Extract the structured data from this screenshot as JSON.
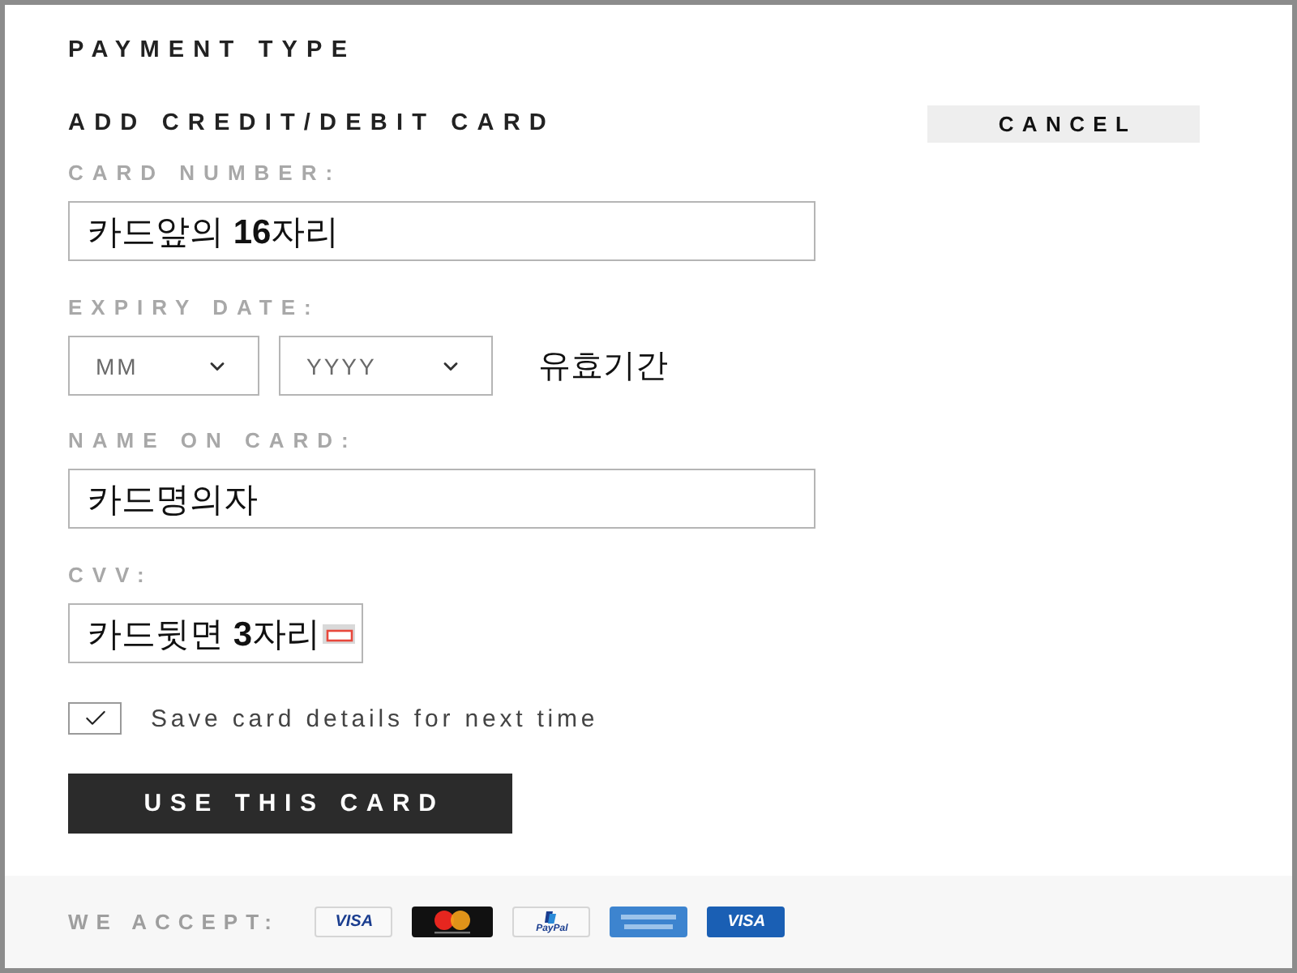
{
  "section_title": "PAYMENT TYPE",
  "form": {
    "title": "ADD CREDIT/DEBIT CARD",
    "cancel_button": "CANCEL",
    "card_number": {
      "label": "CARD NUMBER:",
      "value": "카드앞의 **16**자리"
    },
    "expiry": {
      "label": "EXPIRY DATE:",
      "month": {
        "placeholder": "MM"
      },
      "year": {
        "placeholder": "YYYY"
      },
      "note": "유효기간"
    },
    "name_on_card": {
      "label": "NAME ON CARD:",
      "value": "카드명의자"
    },
    "cvv": {
      "label": "CVV:",
      "value": "카드뒷면 **3**자리"
    },
    "save_card": {
      "label": "Save card details for next time",
      "checked": true
    },
    "submit_button": "USE THIS CARD"
  },
  "footer": {
    "label": "WE ACCEPT:",
    "cards": [
      {
        "kind": "visa",
        "label": "VISA"
      },
      {
        "kind": "mastercard"
      },
      {
        "kind": "paypal",
        "label": "PayPal"
      },
      {
        "kind": "amex"
      },
      {
        "kind": "visa-electron",
        "label": "VISA"
      }
    ]
  }
}
